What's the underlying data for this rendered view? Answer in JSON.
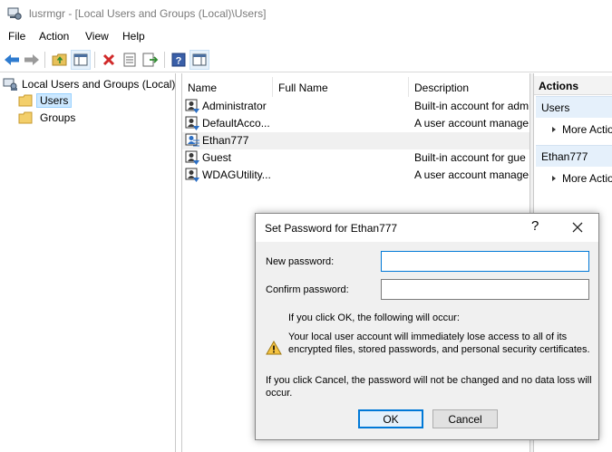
{
  "window": {
    "title": "lusrmgr - [Local Users and Groups (Local)\\Users]",
    "icon": "computer-management-icon"
  },
  "menu": {
    "file": "File",
    "action": "Action",
    "view": "View",
    "help": "Help"
  },
  "toolbar": {
    "icons": [
      "back-arrow-icon",
      "forward-arrow-icon",
      "up-folder-icon",
      "show-hide-tree-icon",
      "delete-icon",
      "properties-icon",
      "export-list-icon",
      "help-icon",
      "show-hide-action-pane-icon"
    ]
  },
  "tree": {
    "root": "Local Users and Groups (Local)",
    "users": "Users",
    "groups": "Groups"
  },
  "list": {
    "columns": {
      "name": "Name",
      "full_name": "Full Name",
      "description": "Description"
    },
    "rows": [
      {
        "name": "Administrator",
        "full_name": "",
        "description": "Built-in account for adm"
      },
      {
        "name": "DefaultAcco...",
        "full_name": "",
        "description": "A user account manage"
      },
      {
        "name": "Ethan777",
        "full_name": "",
        "description": ""
      },
      {
        "name": "Guest",
        "full_name": "",
        "description": "Built-in account for gue"
      },
      {
        "name": "WDAGUtility...",
        "full_name": "",
        "description": "A user account manage"
      }
    ]
  },
  "actions_pane": {
    "header": "Actions",
    "section1": "Users",
    "section1_more": "More Actio",
    "section2": "Ethan777",
    "section2_more": "More Actio"
  },
  "dialog": {
    "title": "Set Password for Ethan777",
    "help": "?",
    "new_password_label": "New password:",
    "new_password_value": "",
    "confirm_password_label": "Confirm password:",
    "confirm_password_value": "",
    "warning_heading": "If you click OK, the following will occur:",
    "warning_line1": "Your local user account will immediately lose access to all of its",
    "warning_line2": "encrypted files, stored passwords, and personal security certificates.",
    "cancel_note_line1": "If you click Cancel, the password will not be changed and no data loss will",
    "cancel_note_line2": "occur.",
    "ok_label": "OK",
    "cancel_label": "Cancel"
  },
  "colors": {
    "accent": "#0078d7",
    "selection": "#cce8ff",
    "action_section": "#e5f0fb"
  }
}
